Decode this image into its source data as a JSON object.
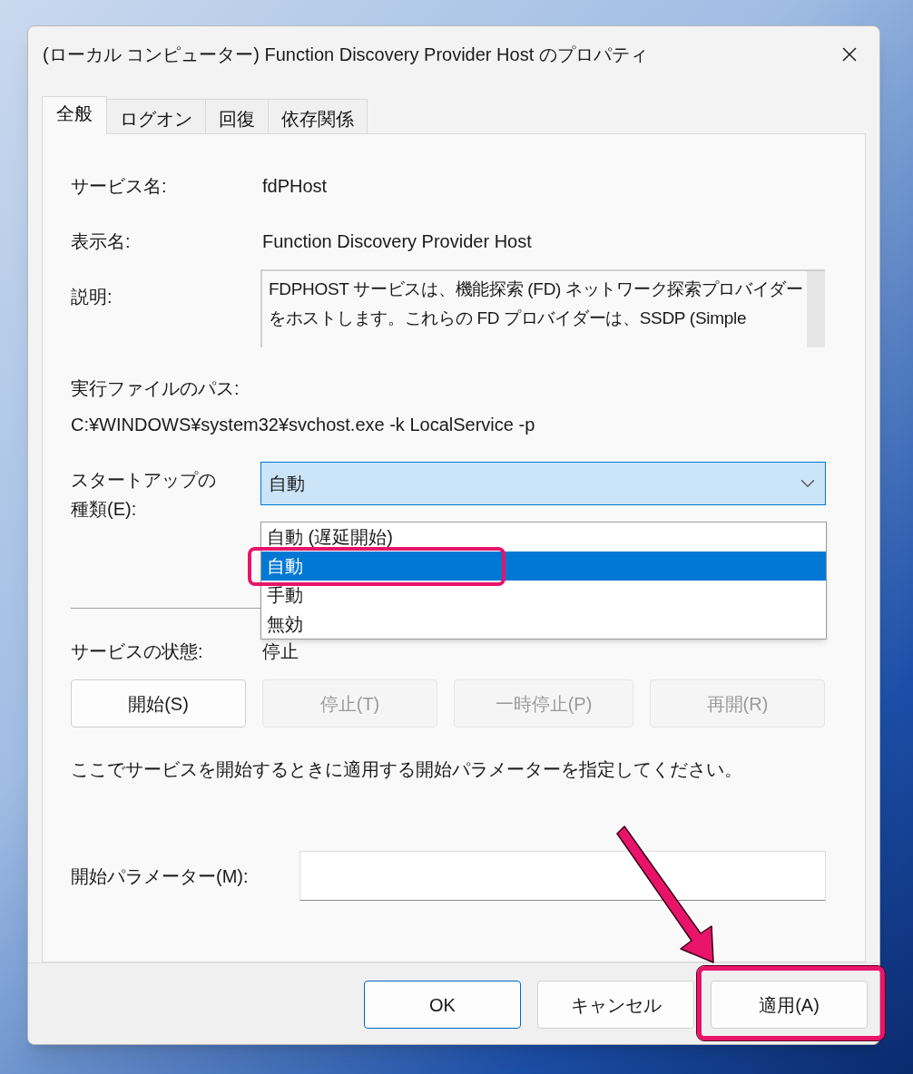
{
  "window": {
    "title": "(ローカル コンピューター) Function Discovery Provider Host のプロパティ"
  },
  "tabs": [
    {
      "label": "全般",
      "selected": true
    },
    {
      "label": "ログオン",
      "selected": false
    },
    {
      "label": "回復",
      "selected": false
    },
    {
      "label": "依存関係",
      "selected": false
    }
  ],
  "fields": [
    {
      "label": "サービス名:",
      "value": "fdPHost"
    },
    {
      "label": "表示名:",
      "value": "Function Discovery Provider Host"
    }
  ],
  "description": {
    "label": "説明:",
    "text": "FDPHOST サービスは、機能探索 (FD) ネットワーク探索プロバイダーをホストします。これらの FD プロバイダーは、SSDP (Simple"
  },
  "path": {
    "label": "実行ファイルのパス:",
    "value": "C:¥WINDOWS¥system32¥svchost.exe -k LocalService -p"
  },
  "startup_type": {
    "label": "スタートアップの種類(E):",
    "value": "自動",
    "expanded": true,
    "options": [
      {
        "label": "自動 (遅延開始)",
        "selected": false
      },
      {
        "label": "自動",
        "selected": true
      },
      {
        "label": "手動",
        "selected": false
      },
      {
        "label": "無効",
        "selected": false
      }
    ]
  },
  "status": {
    "label": "サービスの状態:",
    "value": "停止"
  },
  "service_buttons": [
    {
      "label": "開始(S)",
      "disabled": false
    },
    {
      "label": "停止(T)",
      "disabled": true
    },
    {
      "label": "一時停止(P)",
      "disabled": true
    },
    {
      "label": "再開(R)",
      "disabled": true
    }
  ],
  "hint": "ここでサービスを開始するときに適用する開始パラメーターを指定してください。",
  "parameters": {
    "label": "開始パラメーター(M):"
  },
  "footer_buttons": [
    {
      "label": "OK",
      "default": true
    },
    {
      "label": "キャンセル",
      "default": false
    },
    {
      "label": "適用(A)",
      "default": false
    }
  ]
}
